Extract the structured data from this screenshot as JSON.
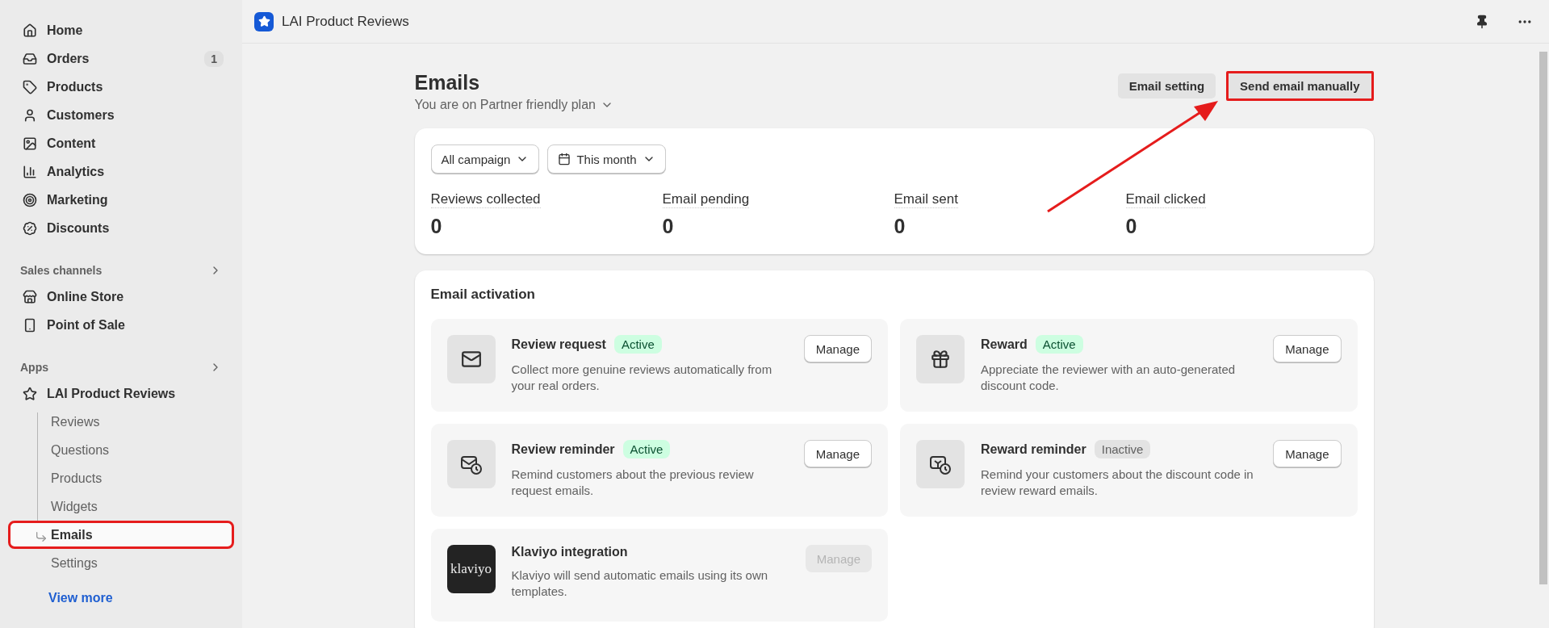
{
  "sidebar": {
    "items": [
      {
        "label": "Home",
        "selected": false
      },
      {
        "label": "Orders",
        "badge": "1",
        "selected": false
      },
      {
        "label": "Products",
        "selected": false
      },
      {
        "label": "Customers",
        "selected": false
      },
      {
        "label": "Content",
        "selected": false
      },
      {
        "label": "Analytics",
        "selected": false
      },
      {
        "label": "Marketing",
        "selected": false
      },
      {
        "label": "Discounts",
        "selected": false
      }
    ],
    "sections": [
      {
        "title": "Sales channels",
        "items": [
          {
            "label": "Online Store",
            "selected": false
          },
          {
            "label": "Point of Sale",
            "selected": false
          }
        ]
      },
      {
        "title": "Apps",
        "items": [
          {
            "label": "LAI Product Reviews",
            "selected": false,
            "children": [
              {
                "label": "Reviews",
                "selected": false,
                "highlighted": false
              },
              {
                "label": "Questions",
                "selected": false,
                "highlighted": false
              },
              {
                "label": "Products",
                "selected": false,
                "highlighted": false
              },
              {
                "label": "Widgets",
                "selected": false,
                "highlighted": false
              },
              {
                "label": "Emails",
                "selected": true,
                "highlighted": true
              },
              {
                "label": "Settings",
                "selected": false,
                "highlighted": false
              }
            ]
          }
        ]
      }
    ],
    "view_more": "View more"
  },
  "topbar": {
    "title": "LAI Product Reviews"
  },
  "page": {
    "title": "Emails",
    "subtitle": "You are on Partner friendly plan",
    "buttons": [
      {
        "label": "Email setting",
        "highlighted": false
      },
      {
        "label": "Send email manually",
        "highlighted": true
      }
    ]
  },
  "stats": {
    "filters": [
      {
        "label": "All campaign"
      },
      {
        "label": "This month"
      }
    ],
    "metrics": [
      {
        "label": "Reviews collected",
        "value": "0"
      },
      {
        "label": "Email pending",
        "value": "0"
      },
      {
        "label": "Email sent",
        "value": "0"
      },
      {
        "label": "Email clicked",
        "value": "0"
      }
    ]
  },
  "activation": {
    "title": "Email activation",
    "cards": [
      {
        "kind": "icon",
        "title": "Review request",
        "status": "Active",
        "active": true,
        "description": "Collect more genuine reviews automatically from your real orders.",
        "button": "Manage",
        "disabled": false
      },
      {
        "kind": "icon",
        "title": "Reward",
        "status": "Active",
        "active": true,
        "description": "Appreciate the reviewer with an auto-generated discount code.",
        "button": "Manage",
        "disabled": false
      },
      {
        "kind": "icon",
        "title": "Review reminder",
        "status": "Active",
        "active": true,
        "description": "Remind customers about the previous review request emails.",
        "button": "Manage",
        "disabled": false
      },
      {
        "kind": "icon",
        "title": "Reward reminder",
        "status": "Inactive",
        "active": false,
        "description": "Remind your customers about the discount code in review reward emails.",
        "button": "Manage",
        "disabled": false
      },
      {
        "kind": "logo",
        "title": "Klaviyo integration",
        "logo_text": "klaviyo",
        "description": "Klaviyo will send automatic emails using its own templates.",
        "button": "Manage",
        "disabled": true
      }
    ]
  }
}
